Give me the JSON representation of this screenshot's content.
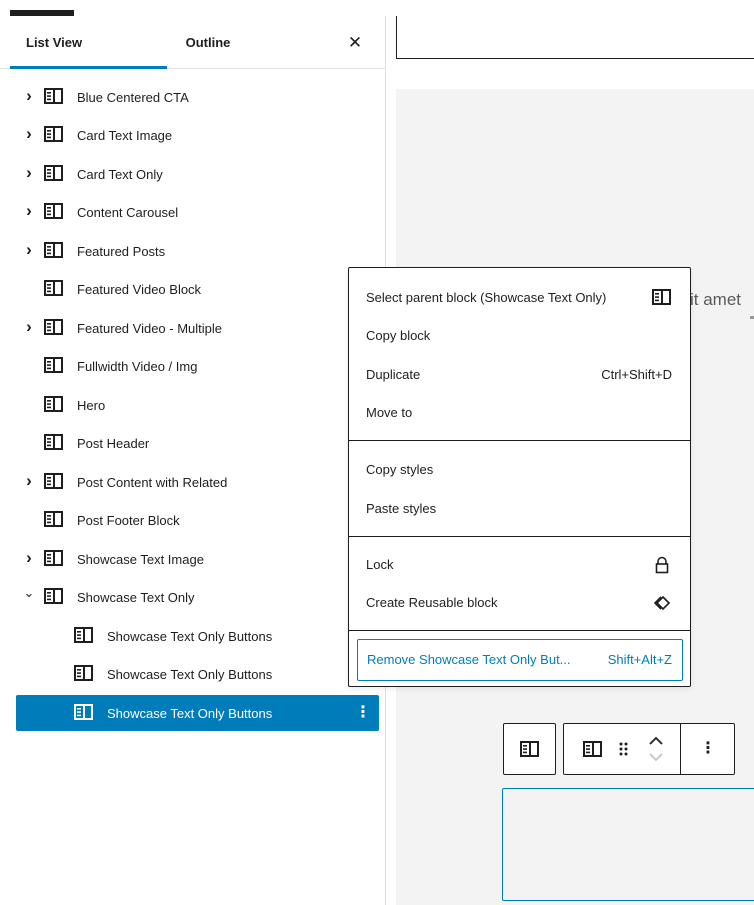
{
  "tabs": {
    "list_view": "List View",
    "outline": "Outline",
    "close": "✕"
  },
  "list": {
    "rows": [
      {
        "label": "Blue Centered CTA",
        "expander": "›"
      },
      {
        "label": "Card Text Image",
        "expander": "›"
      },
      {
        "label": "Card Text Only",
        "expander": "›"
      },
      {
        "label": "Content Carousel",
        "expander": "›"
      },
      {
        "label": "Featured Posts",
        "expander": "›"
      },
      {
        "label": "Featured Video Block",
        "expander": ""
      },
      {
        "label": "Featured Video - Multiple",
        "expander": "›"
      },
      {
        "label": "Fullwidth Video / Img",
        "expander": ""
      },
      {
        "label": "Hero",
        "expander": ""
      },
      {
        "label": "Post Header",
        "expander": ""
      },
      {
        "label": "Post Content with Related",
        "expander": "›"
      },
      {
        "label": "Post Footer Block",
        "expander": ""
      },
      {
        "label": "Showcase Text Image",
        "expander": "›"
      },
      {
        "label": "Showcase Text Only",
        "expander": "⌄"
      },
      {
        "label": "Showcase Text Only Buttons",
        "expander": ""
      },
      {
        "label": "Showcase Text Only Buttons",
        "expander": ""
      },
      {
        "label": "Showcase Text Only Buttons",
        "expander": ""
      }
    ],
    "selected_more": "⋮"
  },
  "menu": {
    "select_parent": "Select parent block (Showcase Text Only)",
    "copy_block": "Copy block",
    "duplicate": "Duplicate",
    "duplicate_shortcut": "Ctrl+Shift+D",
    "move_to": "Move to",
    "copy_styles": "Copy styles",
    "paste_styles": "Paste styles",
    "lock": "Lock",
    "create_reusable": "Create Reusable block",
    "remove": "Remove Showcase Text Only But...",
    "remove_shortcut": "Shift+Alt+Z"
  },
  "canvas": {
    "lorem_fragment": "it amet"
  },
  "toolbar": {
    "more": "⋮",
    "drag": "⠿"
  },
  "colors": {
    "accent": "#007cba",
    "text": "#1e1e1e",
    "canvas_bg": "#f2f3f2"
  },
  "icons": [
    "block-icon",
    "chevron-right-icon",
    "chevron-down-icon",
    "close-icon",
    "lock-icon",
    "reusable-icon",
    "drag-handle-icon",
    "move-up-icon",
    "move-down-icon",
    "more-vertical-icon"
  ]
}
